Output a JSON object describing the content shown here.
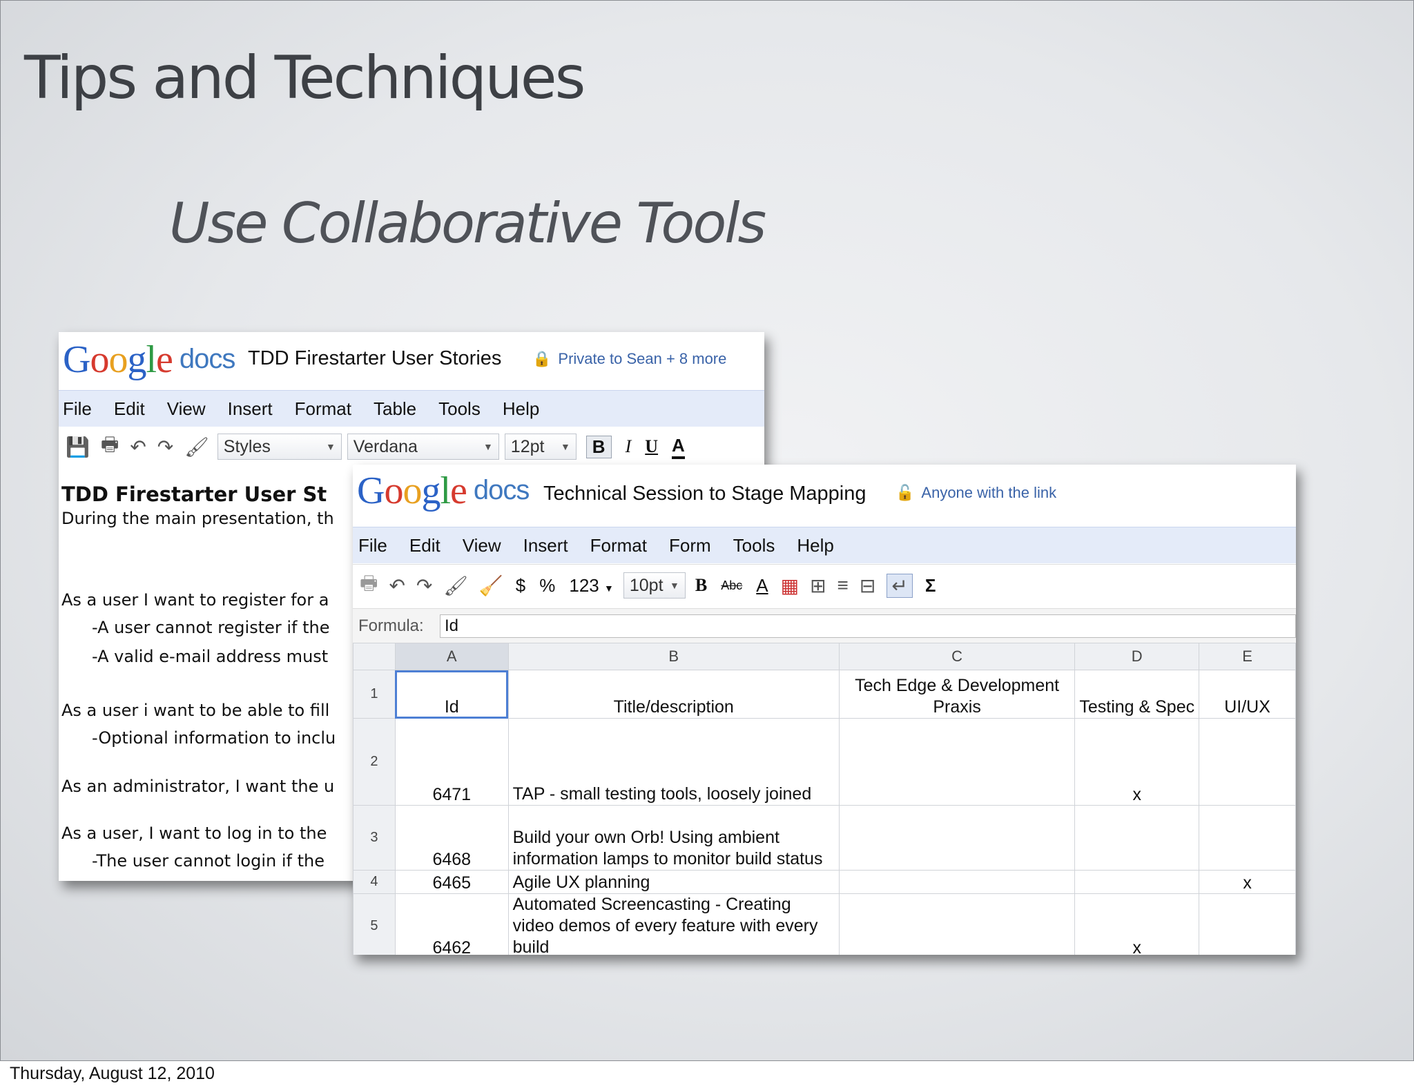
{
  "slide": {
    "title": "Tips and Techniques",
    "subtitle": "Use Collaborative Tools",
    "footer_date": "Thursday, August 12, 2010"
  },
  "doc_window": {
    "logo": "Google",
    "logo_suffix": "docs",
    "title": "TDD Firestarter User Stories",
    "share": "Private to Sean + 8 more",
    "menu": [
      "File",
      "Edit",
      "View",
      "Insert",
      "Format",
      "Table",
      "Tools",
      "Help"
    ],
    "toolbar": {
      "styles": "Styles",
      "font": "Verdana",
      "size": "12pt",
      "bold": "B",
      "italic": "I",
      "underline": "U",
      "text_color": "A"
    },
    "body_lines": [
      "TDD Firestarter User St",
      "During the main presentation, th",
      "As a user I want to register for a",
      "-A user cannot register if the",
      "-A valid e-mail address must",
      "As a user i want to be able to fill",
      "-Optional information to inclu",
      "As an administrator, I want the u",
      "As a user, I want to log in to the",
      "-The user cannot login if the"
    ]
  },
  "sheet_window": {
    "logo": "Google",
    "logo_suffix": "docs",
    "title": "Technical Session to Stage Mapping",
    "share": "Anyone with the link",
    "menu": [
      "File",
      "Edit",
      "View",
      "Insert",
      "Format",
      "Form",
      "Tools",
      "Help"
    ],
    "toolbar": {
      "currency": "$",
      "percent": "%",
      "number_format": "123",
      "size": "10pt",
      "bold": "B",
      "strike": "Abc",
      "text_color": "A",
      "sum": "Σ"
    },
    "formula_label": "Formula:",
    "formula_value": "Id",
    "columns": [
      "A",
      "B",
      "C",
      "D",
      "E"
    ],
    "rows": [
      {
        "num": "1",
        "a": "Id",
        "b": "Title/description",
        "c": "Tech Edge & Development Praxis",
        "d": "Testing & Spec",
        "e": "UI/UX"
      },
      {
        "num": "2",
        "a": "6471",
        "b": "TAP - small testing tools, loosely joined",
        "c": "",
        "d": "x",
        "e": ""
      },
      {
        "num": "3",
        "a": "6468",
        "b": "Build your own Orb! Using ambient information lamps to monitor build status",
        "c": "",
        "d": "",
        "e": ""
      },
      {
        "num": "4",
        "a": "6465",
        "b": "Agile UX planning",
        "c": "",
        "d": "",
        "e": "x"
      },
      {
        "num": "5",
        "a": "6462",
        "b": "Automated Screencasting - Creating video demos of every feature with every build",
        "c": "",
        "d": "x",
        "e": ""
      }
    ]
  }
}
